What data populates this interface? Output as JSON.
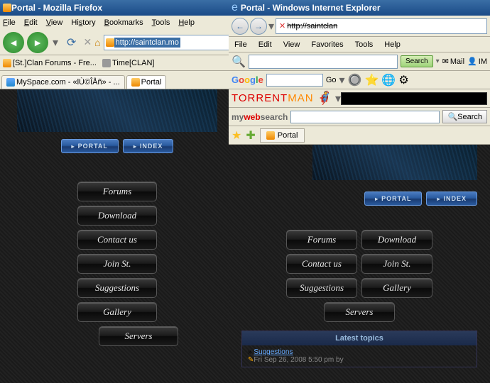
{
  "firefox": {
    "title": "Portal - Mozilla Firefox",
    "menu": [
      "File",
      "Edit",
      "View",
      "History",
      "Bookmarks",
      "Tools",
      "Help"
    ],
    "url": "http://saintclan.mo",
    "bookmarks": [
      "[St.]Clan Forums - Fre...",
      "Time[CLAN]"
    ],
    "tabs": [
      "MySpace.com - «lÙ©ÎÅñ» - ...",
      "Portal"
    ]
  },
  "ie": {
    "title": "Portal - Windows Internet Explorer",
    "url": "http://saintclan",
    "menu": [
      "File",
      "Edit",
      "View",
      "Favorites",
      "Tools",
      "Help"
    ],
    "search_btn": "Search",
    "mail": "Mail",
    "im": "IM",
    "google": "Google",
    "go": "Go",
    "torrent": "TORRENTMAN",
    "mws": [
      "my",
      "web",
      "search"
    ],
    "mws_search": "Search",
    "tab": "Portal"
  },
  "site": {
    "nav": [
      "PORTAL",
      "INDEX"
    ],
    "buttons": [
      "Forums",
      "Download",
      "Contact us",
      "Join St.",
      "Suggestions",
      "Gallery",
      "Servers"
    ],
    "latest": {
      "header": "Latest topics",
      "topic": "Suggestions",
      "meta": "Fri Sep 26, 2008 5:50 pm by"
    }
  }
}
